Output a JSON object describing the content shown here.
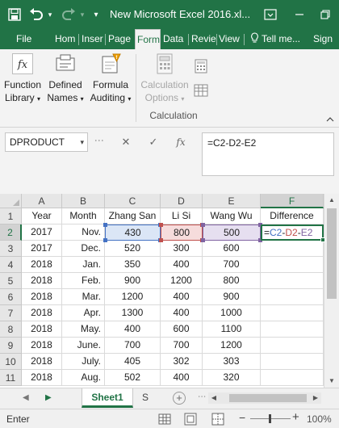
{
  "window": {
    "title": "New Microsoft Excel 2016.xl..."
  },
  "tabs": {
    "file": "File",
    "home": "Hom",
    "insert": "Inser",
    "page": "Page",
    "formulas": "Form",
    "data": "Data",
    "review": "Revie",
    "view": "View",
    "tell": "Tell me...",
    "sign": "Sign"
  },
  "ribbon": {
    "function_library": {
      "line1": "Function",
      "line2": "Library"
    },
    "defined_names": {
      "line1": "Defined",
      "line2": "Names"
    },
    "formula_auditing": {
      "line1": "Formula",
      "line2": "Auditing"
    },
    "calculation_options": {
      "line1": "Calculation",
      "line2": "Options"
    },
    "group_label": "Calculation"
  },
  "formula_bar": {
    "name_box": "DPRODUCT",
    "formula": "=C2-D2-E2"
  },
  "grid": {
    "columns": [
      "A",
      "B",
      "C",
      "D",
      "E",
      "F"
    ],
    "rows": [
      "1",
      "2",
      "3",
      "4",
      "5",
      "6",
      "7",
      "8",
      "9",
      "10",
      "11"
    ],
    "header": [
      "Year",
      "Month",
      "Zhang San",
      "Li Si",
      "Wang Wu",
      "Difference"
    ],
    "data": [
      [
        "2017",
        "Nov.",
        "430",
        "800",
        "500"
      ],
      [
        "2017",
        "Dec.",
        "520",
        "300",
        "600"
      ],
      [
        "2018",
        "Jan.",
        "350",
        "400",
        "700"
      ],
      [
        "2018",
        "Feb.",
        "900",
        "1200",
        "800"
      ],
      [
        "2018",
        "Mar.",
        "1200",
        "400",
        "900"
      ],
      [
        "2018",
        "Apr.",
        "1300",
        "400",
        "1000"
      ],
      [
        "2018",
        "May.",
        "400",
        "600",
        "1100"
      ],
      [
        "2018",
        "June.",
        "700",
        "700",
        "1200"
      ],
      [
        "2018",
        "July.",
        "405",
        "302",
        "303"
      ],
      [
        "2018",
        "Aug.",
        "502",
        "400",
        "320"
      ]
    ],
    "active_cell_formula_tokens": {
      "eq": "=",
      "c": "C2",
      "op1": "-",
      "d": "D2",
      "op2": "-",
      "e": "E2"
    }
  },
  "sheets": {
    "active": "Sheet1",
    "next": "S"
  },
  "status": {
    "mode": "Enter",
    "zoom": "100%"
  },
  "colors": {
    "brand": "#217346",
    "ref_c": "#4472c4",
    "ref_d": "#c0504d",
    "ref_e": "#8064a2"
  }
}
